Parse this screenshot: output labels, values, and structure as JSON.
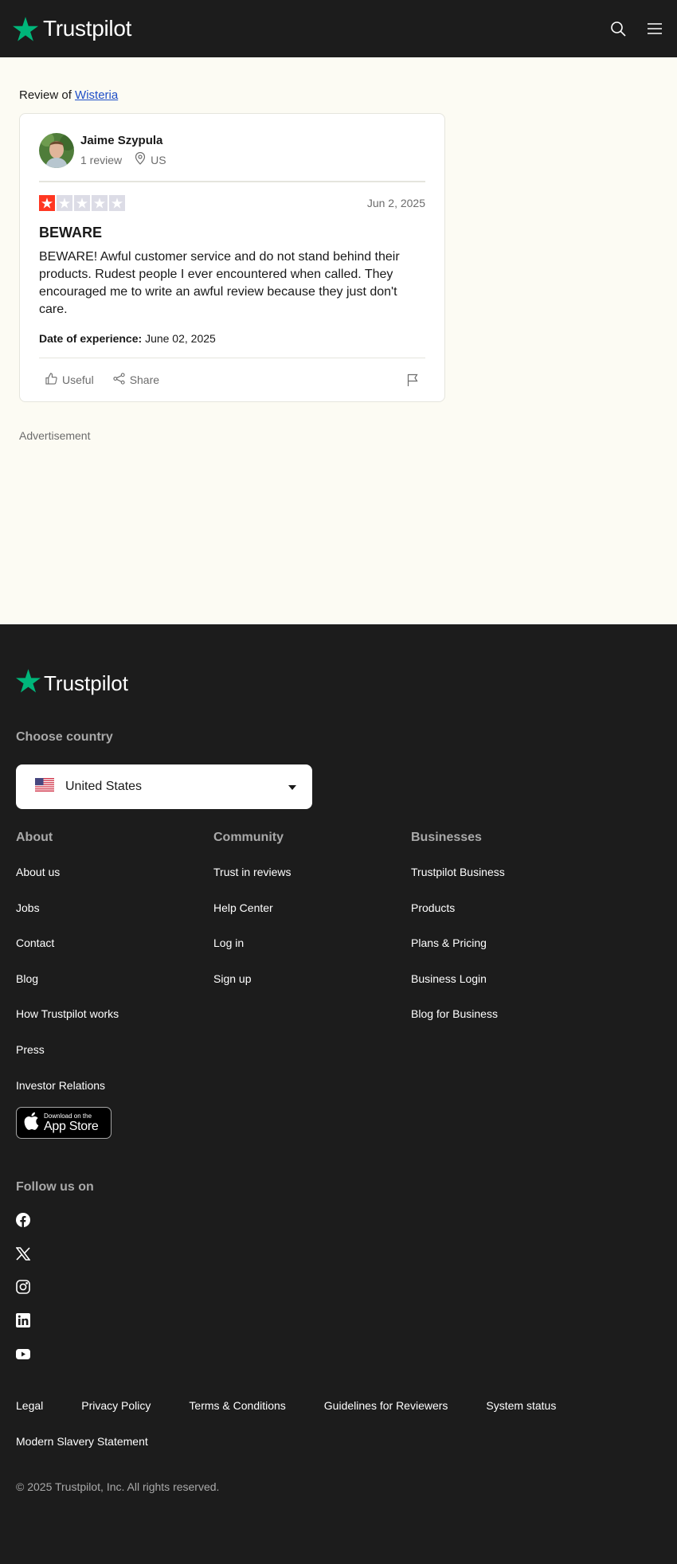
{
  "header": {
    "brand": "Trustpilot",
    "search_icon": "search-icon",
    "menu_icon": "menu-icon"
  },
  "main": {
    "review_of_prefix": "Review of",
    "company": "Wisteria",
    "review": {
      "consumer_name": "Jaime Szypula",
      "review_count": "1 review",
      "country": "US",
      "rating": 1,
      "max_rating": 5,
      "date": "Jun 2, 2025",
      "title": "BEWARE",
      "body": "BEWARE! Awful customer service and do not stand behind their products. Rudest people I ever encountered when called. They encouraged me to write an awful review because they just don't care.",
      "experience_label": "Date of experience:",
      "experience_date": "June 02, 2025",
      "useful_label": "Useful",
      "share_label": "Share"
    },
    "advertisement_label": "Advertisement"
  },
  "footer": {
    "brand": "Trustpilot",
    "choose_country": "Choose country",
    "country": "United States",
    "columns": [
      {
        "heading": "About",
        "links": [
          "About us",
          "Jobs",
          "Contact",
          "Blog",
          "How Trustpilot works",
          "Press",
          "Investor Relations"
        ]
      },
      {
        "heading": "Community",
        "links": [
          "Trust in reviews",
          "Help Center",
          "Log in",
          "Sign up"
        ]
      },
      {
        "heading": "Businesses",
        "links": [
          "Trustpilot Business",
          "Products",
          "Plans & Pricing",
          "Business Login",
          "Blog for Business"
        ]
      }
    ],
    "app_store": {
      "small": "Download on the",
      "big": "App Store"
    },
    "follow_us": "Follow us on",
    "socials": [
      "facebook-icon",
      "x-icon",
      "instagram-icon",
      "linkedin-icon",
      "youtube-icon"
    ],
    "legal": [
      "Legal",
      "Privacy Policy",
      "Terms & Conditions",
      "Guidelines for Reviewers",
      "System status",
      "Modern Slavery Statement"
    ],
    "copyright": "© 2025 Trustpilot, Inc. All rights reserved."
  },
  "colors": {
    "brand_green": "#00b67a",
    "star_red": "#ff3722",
    "link_blue": "#1e4ec7",
    "dark_bg": "#1c1c1c",
    "page_bg": "#fcfbf3"
  }
}
